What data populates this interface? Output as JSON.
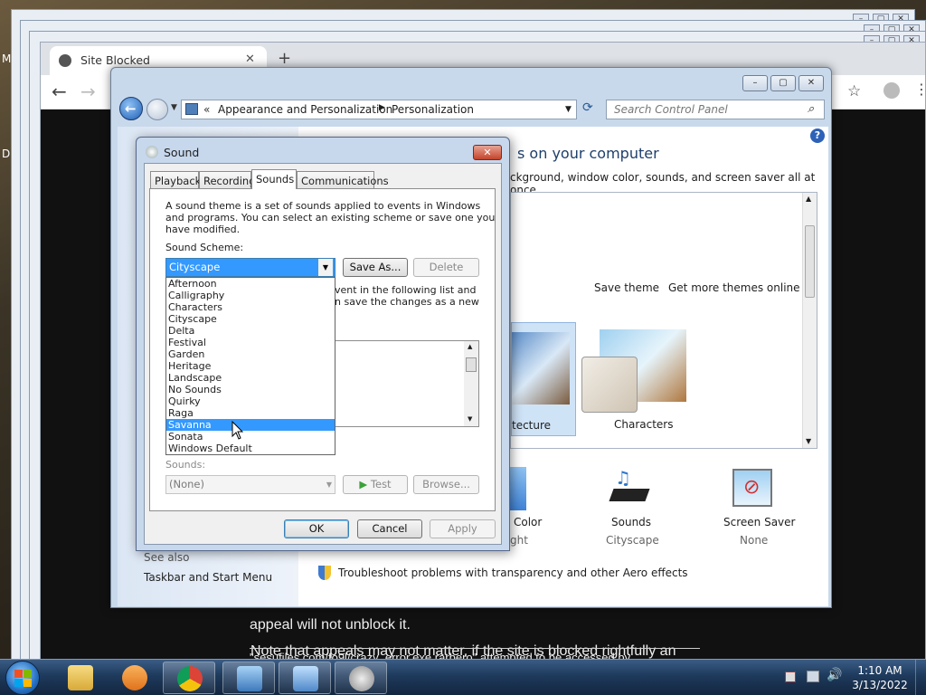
{
  "desktop": {
    "left_letters": [
      "M",
      "D"
    ]
  },
  "browser": {
    "tab_title": "Site Blocked",
    "page_text_1": "Note that appeals may not matter, if the site is blocked rightfully an",
    "page_text_2": "appeal will not unblock it.",
    "page_text_3": "\"sesufiles.com/fo9l/crazy_error.exe rarbero\" attempted to be accessed by"
  },
  "control_panel": {
    "breadcrumb_root": "Appearance and Personalization",
    "breadcrumb_leaf": "Personalization",
    "search_placeholder": "Search Control Panel",
    "heading": "s on your computer",
    "subheading": "ckground, window color, sounds, and screen saver all at once.",
    "save_theme": "Save theme",
    "more_themes": "Get more themes online",
    "theme_architecture": "tecture",
    "theme_characters": "Characters",
    "window_color_label": "Color",
    "window_color_value": "ght",
    "sounds_label": "Sounds",
    "sounds_value": "Cityscape",
    "screensaver_label": "Screen Saver",
    "screensaver_value": "None",
    "see_also": "See also",
    "taskbar_link": "Taskbar and Start Menu",
    "troubleshoot": "Troubleshoot problems with transparency and other Aero effects"
  },
  "sound_dialog": {
    "title": "Sound",
    "tabs": [
      "Playback",
      "Recording",
      "Sounds",
      "Communications"
    ],
    "description": [
      "A sound theme is a set of sounds applied to events in Windows",
      "and programs.  You can select an existing scheme or save one you",
      "have modified."
    ],
    "scheme_label": "Sound Scheme:",
    "scheme_value": "Cityscape",
    "save_as": "Save As...",
    "delete": "Delete",
    "behind_text_1": "vent in the following list and",
    "behind_text_2": "n save the changes as a new",
    "scheme_options": [
      "Afternoon",
      "Calligraphy",
      "Characters",
      "Cityscape",
      "Delta",
      "Festival",
      "Garden",
      "Heritage",
      "Landscape",
      "No Sounds",
      "Quirky",
      "Raga",
      "Savanna",
      "Sonata",
      "Windows Default"
    ],
    "highlighted_option": "Savanna",
    "sounds_label": "Sounds:",
    "sounds_value": "(None)",
    "test": "Test",
    "browse": "Browse...",
    "ok": "OK",
    "cancel": "Cancel",
    "apply": "Apply"
  },
  "taskbar": {
    "time": "1:10 AM",
    "date": "3/13/2022"
  }
}
